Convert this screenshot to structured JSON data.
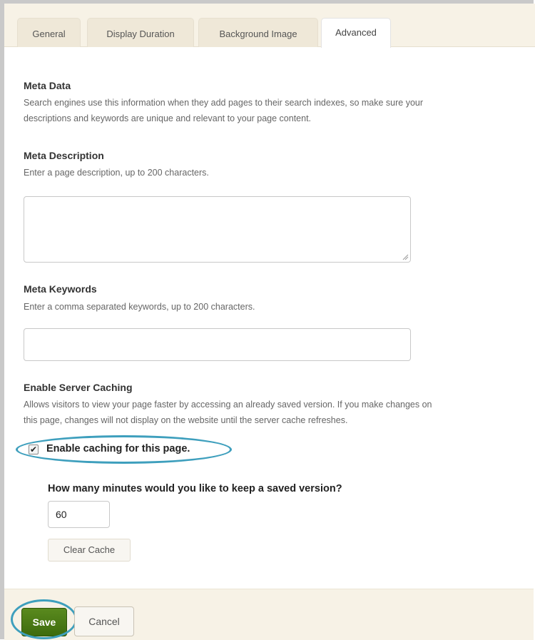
{
  "tabs": [
    {
      "label": "General"
    },
    {
      "label": "Display Duration"
    },
    {
      "label": "Background Image"
    },
    {
      "label": "Advanced"
    }
  ],
  "meta_data": {
    "title": "Meta Data",
    "help_line1": "Search engines use this information when they add pages to their search indexes, so make sure your",
    "help_line2": "descriptions and keywords are unique and relevant to your page content."
  },
  "meta_description": {
    "title": "Meta Description",
    "help": "Enter a page description, up to 200 characters.",
    "value": ""
  },
  "meta_keywords": {
    "title": "Meta Keywords",
    "help": "Enter a comma separated keywords, up to 200 characters.",
    "value": ""
  },
  "server_caching": {
    "title": "Enable Server Caching",
    "help_line1": "Allows visitors to view your page faster by accessing an already saved version. If you make changes on",
    "help_line2": "this page, changes will not display on the website until the server cache refreshes.",
    "checkbox_label": "Enable caching for this page.",
    "checked": true,
    "minutes_label": "How many minutes would you like to keep a saved version?",
    "minutes_value": "60",
    "clear_cache_label": "Clear Cache"
  },
  "footer": {
    "save_label": "Save",
    "cancel_label": "Cancel"
  },
  "colors": {
    "accent_highlight": "#3e9fbd",
    "save_green": "#4a7a14",
    "panel_beige": "#f7f2e6"
  }
}
